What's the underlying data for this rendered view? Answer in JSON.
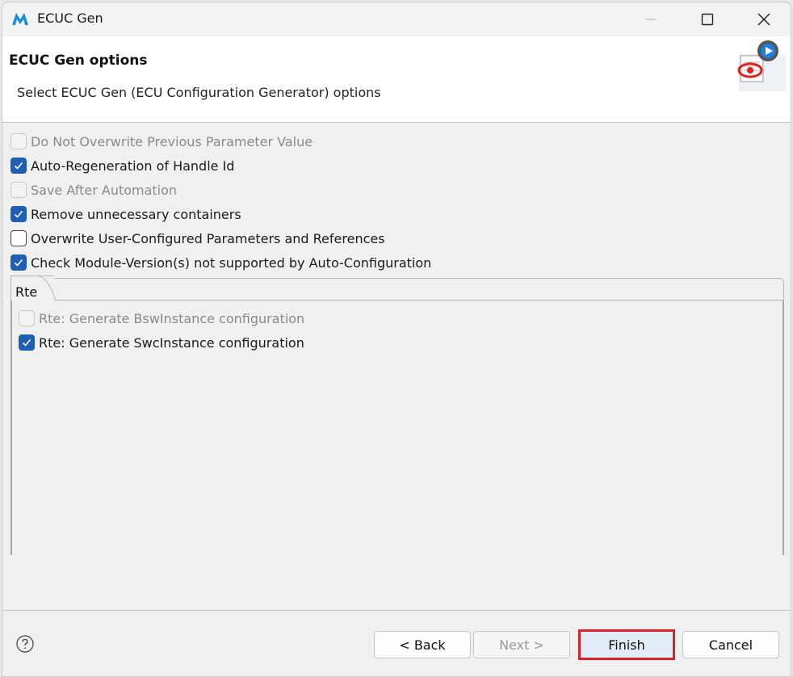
{
  "window": {
    "title": "ECUC Gen"
  },
  "header": {
    "title": "ECUC Gen options",
    "description": "Select ECUC Gen (ECU Configuration Generator) options"
  },
  "options": [
    {
      "label": "Do Not Overwrite Previous Parameter Value",
      "checked": false,
      "enabled": false
    },
    {
      "label": "Auto-Regeneration of Handle Id",
      "checked": true,
      "enabled": true
    },
    {
      "label": "Save After Automation",
      "checked": false,
      "enabled": false
    },
    {
      "label": "Remove unnecessary containers",
      "checked": true,
      "enabled": true
    },
    {
      "label": "Overwrite User-Configured Parameters and References",
      "checked": false,
      "enabled": true
    },
    {
      "label": "Check Module-Version(s) not supported by Auto-Configuration",
      "checked": true,
      "enabled": true
    }
  ],
  "tabs": [
    {
      "label": "Rte",
      "options": [
        {
          "label": "Rte: Generate BswInstance configuration",
          "checked": false,
          "enabled": false
        },
        {
          "label": "Rte: Generate SwcInstance configuration",
          "checked": true,
          "enabled": true
        }
      ]
    }
  ],
  "buttons": {
    "back": "< Back",
    "next": "Next >",
    "finish": "Finish",
    "cancel": "Cancel"
  },
  "colors": {
    "checkbox_checked": "#1e5fb4",
    "highlight_border": "#d9222a",
    "app_icon": "#1b8fd6"
  }
}
